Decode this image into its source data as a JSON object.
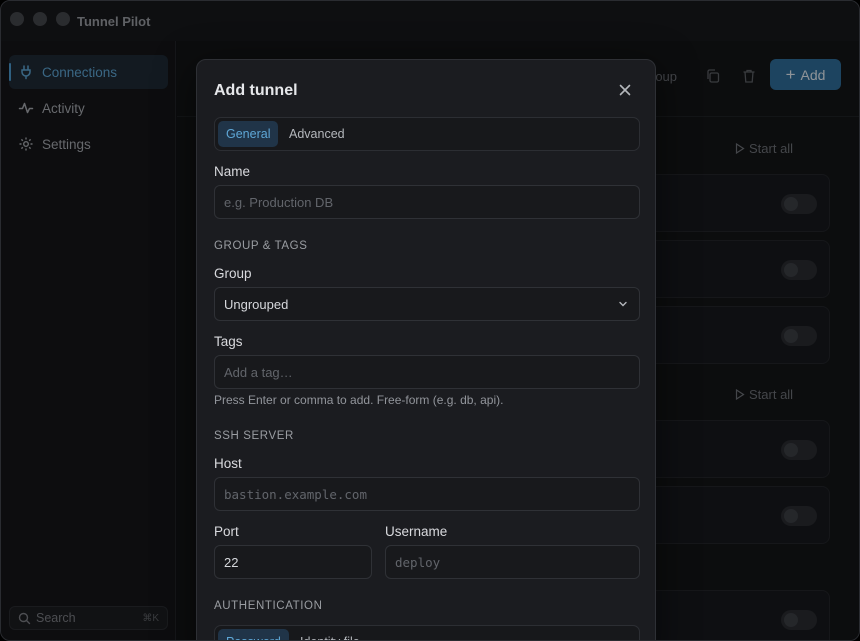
{
  "app": {
    "title": "Tunnel Pilot"
  },
  "sidebar": {
    "items": [
      {
        "label": "Connections",
        "icon": "plug-icon",
        "active": true
      },
      {
        "label": "Activity",
        "icon": "activity-icon",
        "active": false
      },
      {
        "label": "Settings",
        "icon": "gear-icon",
        "active": false
      }
    ],
    "search": {
      "label": "Search",
      "shortcut": "⌘K"
    }
  },
  "main": {
    "toolbar": {
      "group_text": "roup",
      "add_label": "Add"
    },
    "start_all_label": "Start all"
  },
  "modal": {
    "title": "Add tunnel",
    "tabs": [
      {
        "label": "General",
        "active": true
      },
      {
        "label": "Advanced",
        "active": false
      }
    ],
    "name": {
      "label": "Name",
      "placeholder": "e.g. Production DB"
    },
    "group_tags_section": "GROUP & TAGS",
    "group": {
      "label": "Group",
      "value": "Ungrouped"
    },
    "tags": {
      "label": "Tags",
      "placeholder": "Add a tag…",
      "hint": "Press Enter or comma to add. Free-form (e.g. db, api)."
    },
    "ssh_section": "SSH SERVER",
    "host": {
      "label": "Host",
      "placeholder": "bastion.example.com"
    },
    "port": {
      "label": "Port",
      "value": "22"
    },
    "username": {
      "label": "Username",
      "placeholder": "deploy"
    },
    "auth_section": "AUTHENTICATION",
    "auth_tabs": [
      {
        "label": "Password",
        "active": true
      },
      {
        "label": "Identity file",
        "active": false
      }
    ]
  },
  "colors": {
    "accent": "#2f6f9c",
    "accent_text": "#5ea7d6"
  }
}
